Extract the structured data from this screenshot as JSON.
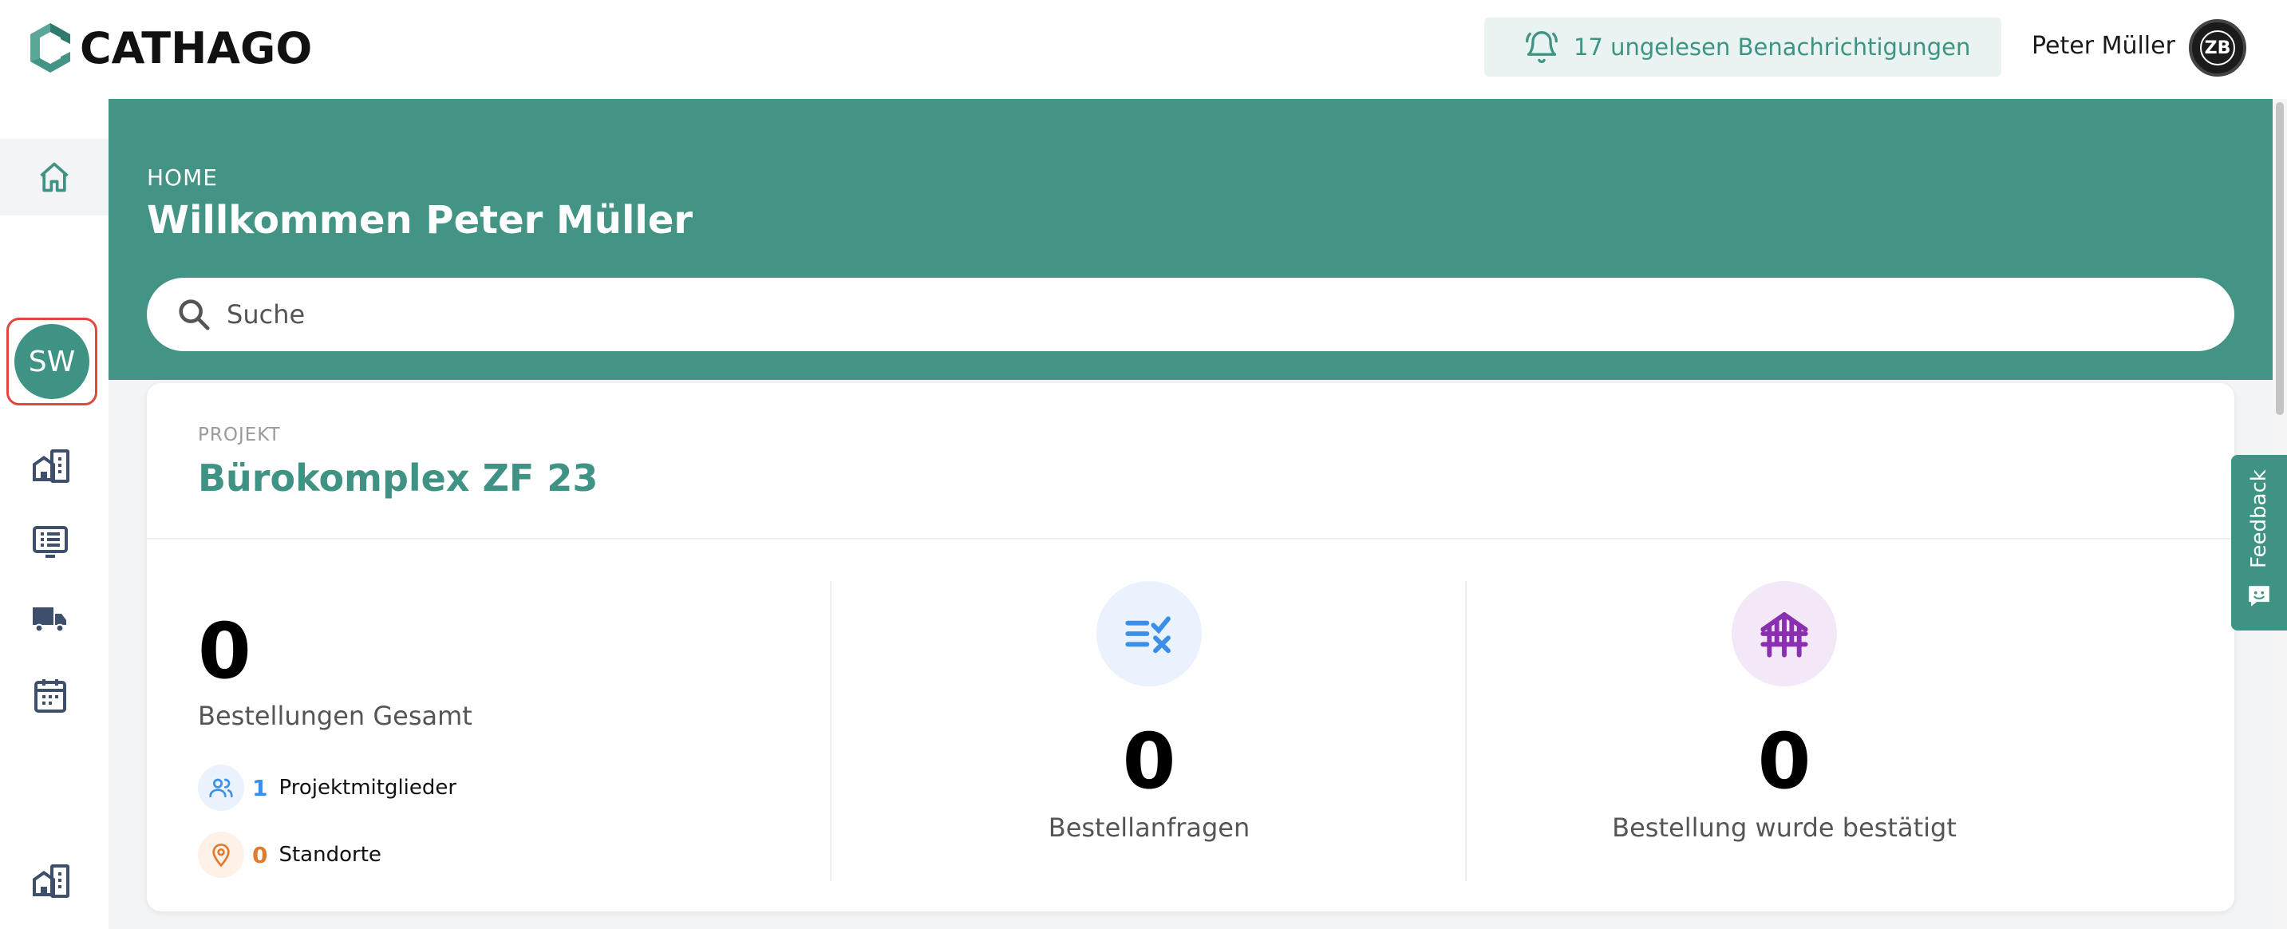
{
  "app": {
    "logo_text": "CATHAGO",
    "brand_color": "#439485"
  },
  "topbar": {
    "notifications_label": "17 ungelesen Benachrichtigungen",
    "user_name": "Peter Müller",
    "user_avatar_initials": "ZB"
  },
  "sidebar": {
    "org_initials": "SW",
    "icons": [
      "home-icon",
      "buildings-icon",
      "list-icon",
      "truck-icon",
      "calendar-icon",
      "buildings-icon"
    ]
  },
  "header": {
    "breadcrumb": "HOME",
    "welcome": "Willkommen Peter Müller"
  },
  "search": {
    "placeholder": "Suche"
  },
  "project": {
    "label": "PROJEKT",
    "name": "Bürokomplex ZF 23",
    "total_orders_value": "0",
    "total_orders_label": "Bestellungen Gesamt",
    "members_count": "1",
    "members_label": "Projektmitglieder",
    "locations_count": "0",
    "locations_label": "Standorte",
    "requests_value": "0",
    "requests_label": "Bestellanfragen",
    "confirmed_value": "0",
    "confirmed_label": "Bestellung wurde bestätigt"
  },
  "feedback": {
    "label": "Feedback"
  }
}
